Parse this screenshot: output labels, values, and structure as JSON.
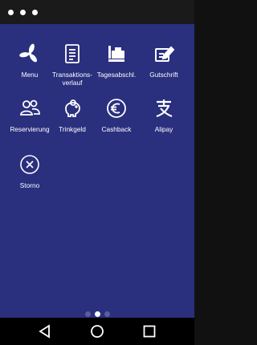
{
  "home": {
    "apps": [
      {
        "label": "Menu",
        "icon": "pinwheel-icon"
      },
      {
        "label": "Transaktions-\nverlauf",
        "icon": "document-list-icon"
      },
      {
        "label": "Tagesabschl.",
        "icon": "cash-register-icon"
      },
      {
        "label": "Gutschrift",
        "icon": "edit-note-icon"
      },
      {
        "label": "Reservierung",
        "icon": "people-icon"
      },
      {
        "label": "Trinkgeld",
        "icon": "piggy-bank-icon"
      },
      {
        "label": "Cashback",
        "icon": "euro-circle-icon"
      },
      {
        "label": "Alipay",
        "icon": "alipay-icon"
      },
      {
        "label": "Storno",
        "icon": "cancel-circle-icon"
      }
    ],
    "page_indicator": {
      "count": 3,
      "active_index": 1
    }
  },
  "colors": {
    "background": "#2a2f7e",
    "status_bar": "#1a1a1a",
    "nav_bar": "#000000",
    "text": "#ffffff"
  }
}
